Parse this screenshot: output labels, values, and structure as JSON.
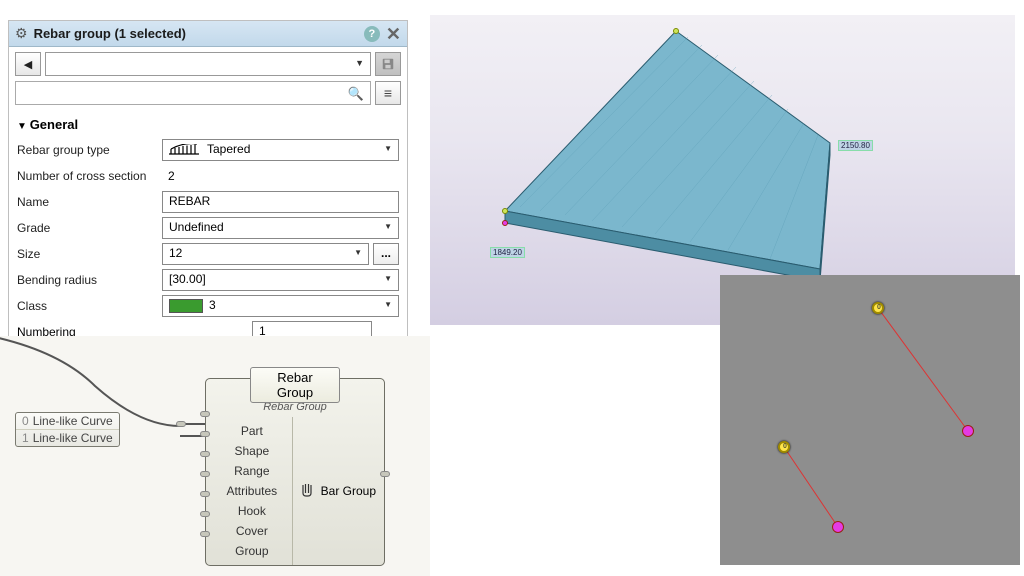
{
  "props": {
    "title": "Rebar group (1 selected)",
    "section_general": "General",
    "labels": {
      "type": "Rebar group type",
      "cross": "Number of cross section",
      "name": "Name",
      "grade": "Grade",
      "size": "Size",
      "bend": "Bending radius",
      "class": "Class",
      "numbering": "Numbering"
    },
    "values": {
      "type": "Tapered",
      "cross": "2",
      "name": "REBAR",
      "grade": "Undefined",
      "size": "12",
      "bend": "[30.00]",
      "class": "3",
      "numbering": "1"
    }
  },
  "viewport3d": {
    "dim1": "2150.80",
    "dim2": "1849.20"
  },
  "gh": {
    "param_lines": [
      "Line-like Curve",
      "Line-like Curve"
    ],
    "comp_title": "Rebar Group",
    "comp_subtitle": "Rebar Group",
    "inputs": [
      "Part",
      "Shape",
      "Range",
      "Attributes",
      "Hook",
      "Cover",
      "Group"
    ],
    "output": "Bar Group"
  }
}
